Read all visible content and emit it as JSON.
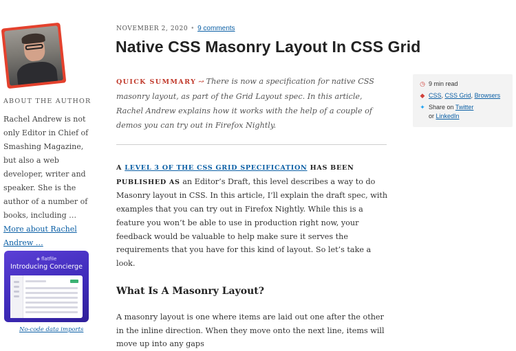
{
  "sidebar": {
    "about_heading": "About The Author",
    "bio_text": "Rachel Andrew is not only Editor in Chief of Smashing Magazine, but also a web developer, writer and speaker. She is the author of a number of books, including …",
    "bio_link": "More about Rachel Andrew …",
    "ad": {
      "brand": "flatfile",
      "headline": "Introducing Concierge",
      "caption": "No-code data imports"
    }
  },
  "article": {
    "date": "November 2, 2020",
    "comments_link": "9 comments",
    "title": "Native CSS Masonry Layout In CSS Grid",
    "summary_label": "Quick Summary",
    "summary_text": "There is now a specification for native CSS masonry layout, as part of the Grid Layout spec. In this article, Rachel Andrew explains how it works with the help of a couple of demos you can try out in Firefox Nightly.",
    "intro_prefix": "A",
    "intro_link": "Level 3 of the CSS Grid specification",
    "intro_lead_rest": "has been published as",
    "intro_text": "an Editor’s Draft, this level describes a way to do Masonry layout in CSS. In this article, I’ll explain the draft spec, with examples that you can try out in Firefox Nightly. While this is a feature you won’t be able to use in production right now, your feedback would be valuable to help make sure it serves the requirements that you have for this kind of layout. So let’s take a look.",
    "heading2": "What Is A Masonry Layout?",
    "para2": "A masonry layout is one where items are laid out one after the other in the inline direction. When they move onto the next line, items will move up into any gaps"
  },
  "info_box": {
    "read_time": "9 min read",
    "tags": [
      "CSS",
      "CSS Grid",
      "Browsers"
    ],
    "share_prefix": "Share on",
    "share_twitter": "Twitter",
    "share_or": "or",
    "share_linkedin": "LinkedIn"
  },
  "colors": {
    "accent_red": "#c0392b",
    "link_blue": "#0b5fa5",
    "ad_purple": "#4a31c7"
  },
  "icons": [
    "clock-icon",
    "tag-icon",
    "twitter-icon",
    "arrow-icon"
  ]
}
